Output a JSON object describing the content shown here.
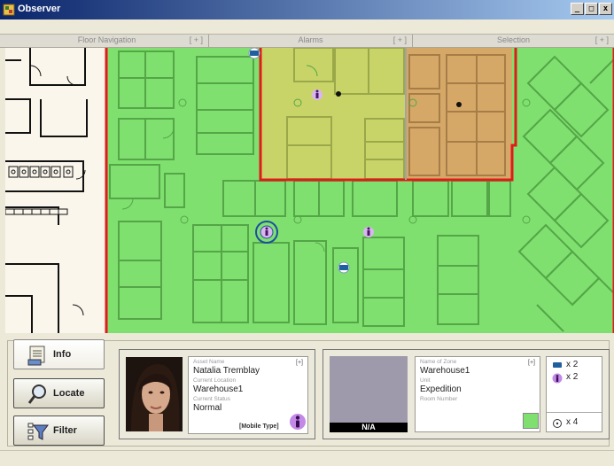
{
  "window": {
    "title": "Observer",
    "min_glyph": "_",
    "max_glyph": "□",
    "close_glyph": "x"
  },
  "panels": [
    {
      "label": "Floor Navigation",
      "expand": "[ + ]"
    },
    {
      "label": "Alarms",
      "expand": "[ + ]"
    },
    {
      "label": "Selection",
      "expand": "[ + ]"
    }
  ],
  "sidebar": {
    "info": "Info",
    "locate": "Locate",
    "filter": "Filter"
  },
  "asset": {
    "expand": "[+]",
    "name_label": "Asset Name",
    "name": "Natalia Tremblay",
    "location_label": "Current Location",
    "location": "Warehouse1",
    "status_label": "Current Status",
    "status": "Normal",
    "type": "[Mobile Type]"
  },
  "zone": {
    "image_caption": "N/A",
    "expand": "[+]",
    "name_label": "Name of Zone",
    "name": "Warehouse1",
    "unit_label": "Unit",
    "unit": "Expedition",
    "room_label": "Room Number",
    "room": "",
    "swatch_color": "#7fe06f"
  },
  "counts": {
    "static_tags": "x 2",
    "mobile_tags": "x 2",
    "readers": "x 4"
  },
  "colors": {
    "zone_green": "#7fe06f",
    "zone_yellow": "#c9d468",
    "zone_orange": "#d6a868",
    "boundary_red": "#e11a1a",
    "person_marker": "#c28ae6",
    "tag_blue": "#2a8fd6"
  }
}
